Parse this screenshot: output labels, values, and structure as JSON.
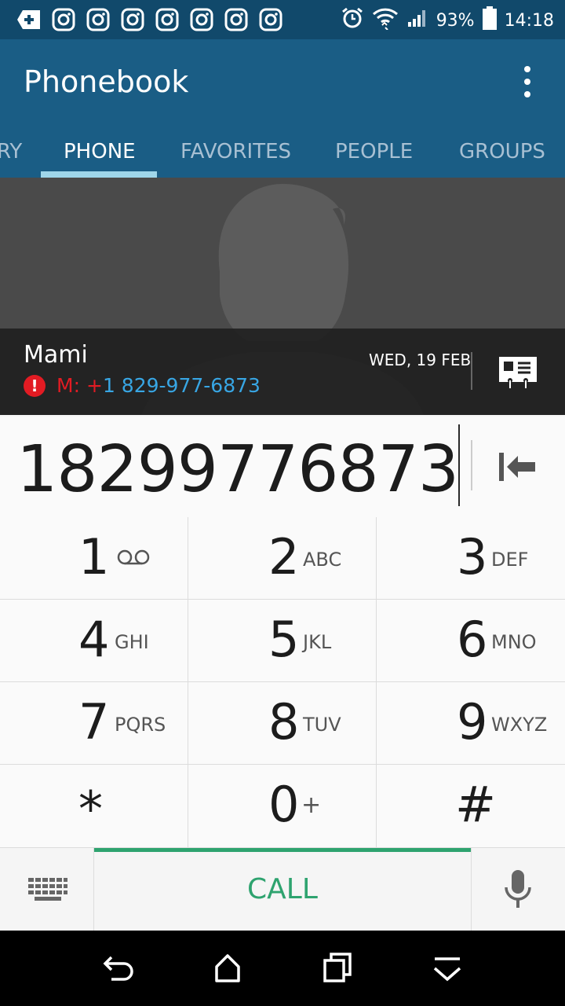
{
  "status_bar": {
    "battery": "93%",
    "time": "14:18",
    "left_icons": [
      "add-box-icon",
      "instagram-icon",
      "instagram-icon",
      "instagram-icon",
      "instagram-icon",
      "instagram-icon",
      "instagram-icon",
      "instagram-icon"
    ],
    "right_icons": [
      "alarm-icon",
      "wifi-icon",
      "signal-icon",
      "battery-icon"
    ]
  },
  "app": {
    "title": "Phonebook"
  },
  "tabs": [
    {
      "label": "RY"
    },
    {
      "label": "PHONE"
    },
    {
      "label": "FAVORITES"
    },
    {
      "label": "PEOPLE"
    },
    {
      "label": "GROUPS"
    }
  ],
  "contact": {
    "name": "Mami",
    "number_label": "M:",
    "number_plus": "+",
    "number": "1 829-977-6873",
    "date": "WED, 19 FEB"
  },
  "dialer": {
    "digits": "18299776873"
  },
  "keys": [
    {
      "digit": "1",
      "letters": ""
    },
    {
      "digit": "2",
      "letters": "ABC"
    },
    {
      "digit": "3",
      "letters": "DEF"
    },
    {
      "digit": "4",
      "letters": "GHI"
    },
    {
      "digit": "5",
      "letters": "JKL"
    },
    {
      "digit": "6",
      "letters": "MNO"
    },
    {
      "digit": "7",
      "letters": "PQRS"
    },
    {
      "digit": "8",
      "letters": "TUV"
    },
    {
      "digit": "9",
      "letters": "WXYZ"
    },
    {
      "digit": "*",
      "letters": ""
    },
    {
      "digit": "0",
      "letters": "+"
    },
    {
      "digit": "#",
      "letters": ""
    }
  ],
  "call_button": {
    "label": "CALL"
  },
  "colors": {
    "appbar": "#1a5d85",
    "statusbar": "#11496b",
    "call": "#2ea36f",
    "missed": "#e21b23",
    "link": "#38a6e4"
  }
}
